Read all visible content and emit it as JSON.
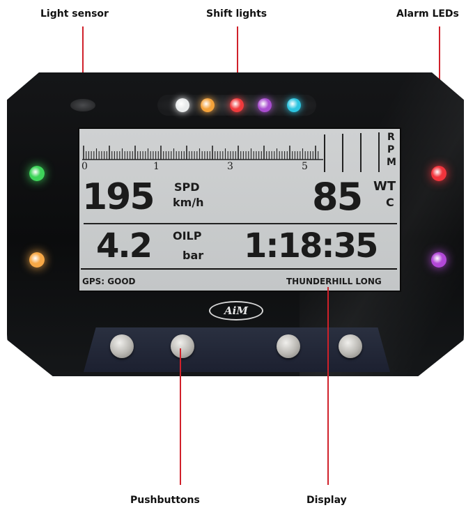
{
  "callouts": {
    "light_sensor": "Light sensor",
    "shift_lights": "Shift lights",
    "alarm_leds": "Alarm LEDs",
    "pushbuttons": "Pushbuttons",
    "display": "Display"
  },
  "device": {
    "brand_logo": "AiM",
    "shift_light_colors": [
      "#e9ebec",
      "#f4a23a",
      "#f03a3c",
      "#a94dd0",
      "#2cc4e0"
    ],
    "alarm_leds": {
      "left_top": "#3ed45a",
      "left_bottom": "#f7a846",
      "right_top": "#f2343c",
      "right_bottom": "#b248d8"
    },
    "pushbutton_count": 4
  },
  "display": {
    "rpm_label": [
      "R",
      "P",
      "M"
    ],
    "rpm_scale": [
      "0",
      "1",
      "3",
      "5"
    ],
    "speed": {
      "value": "195",
      "label": "SPD",
      "unit": "km/h"
    },
    "water_temp": {
      "value": "85",
      "label": "WT",
      "unit": "C"
    },
    "oil_pressure": {
      "value": "4.2",
      "label": "OILP",
      "unit": "bar"
    },
    "lap_time": {
      "value": "1:18:35"
    },
    "gps_status": "GPS: GOOD",
    "track_name": "THUNDERHILL LONG"
  }
}
